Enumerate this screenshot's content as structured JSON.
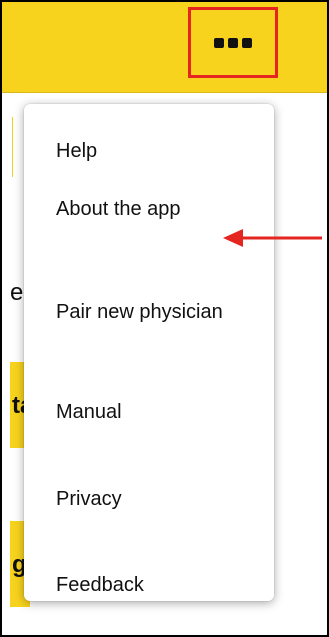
{
  "header": {
    "menu_icon": "more-horizontal-icon",
    "bg_color": "#F8D31E",
    "highlight_color": "#E5251F"
  },
  "background_fragments": {
    "text_1": "e",
    "block_1_text": "ta",
    "block_2_text": "g"
  },
  "menu": {
    "items": [
      {
        "label": "Help"
      },
      {
        "label": "About the app"
      },
      {
        "label": "Pair new physician"
      },
      {
        "label": "Manual"
      },
      {
        "label": "Privacy"
      },
      {
        "label": "Feedback"
      }
    ]
  },
  "annotation": {
    "arrow_color": "#E5251F",
    "arrow_target": "About the app"
  }
}
